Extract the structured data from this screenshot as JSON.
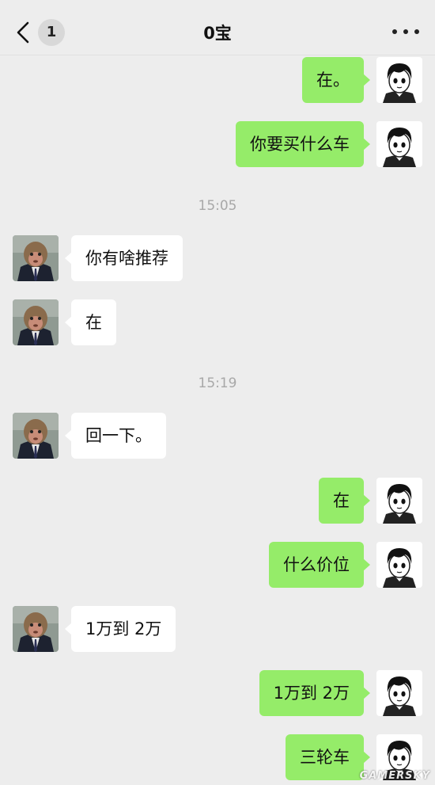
{
  "header": {
    "unread_count": "1",
    "title": "0宝"
  },
  "messages": [
    {
      "side": "right",
      "text": "在。"
    },
    {
      "side": "right",
      "text": "你要买什么车"
    },
    {
      "time": "15:05"
    },
    {
      "side": "left",
      "text": "你有啥推荐"
    },
    {
      "side": "left",
      "text": "在"
    },
    {
      "time": "15:19"
    },
    {
      "side": "left",
      "text": "回一下。"
    },
    {
      "side": "right",
      "text": "在"
    },
    {
      "side": "right",
      "text": "什么价位"
    },
    {
      "side": "left",
      "text": "1万到 2万"
    },
    {
      "side": "right",
      "text": "1万到 2万"
    },
    {
      "side": "right",
      "text": "三轮车"
    }
  ],
  "colors": {
    "background": "#ededed",
    "outgoing_bubble": "#95ec69",
    "incoming_bubble": "#ffffff",
    "timestamp": "#a8a8a8"
  },
  "icons": {
    "back": "chevron-left-icon",
    "more": "more-dots-icon",
    "contact_avatar": "monkey-avatar",
    "self_avatar": "anime-boy-avatar"
  },
  "watermark": "GAMERSKY"
}
